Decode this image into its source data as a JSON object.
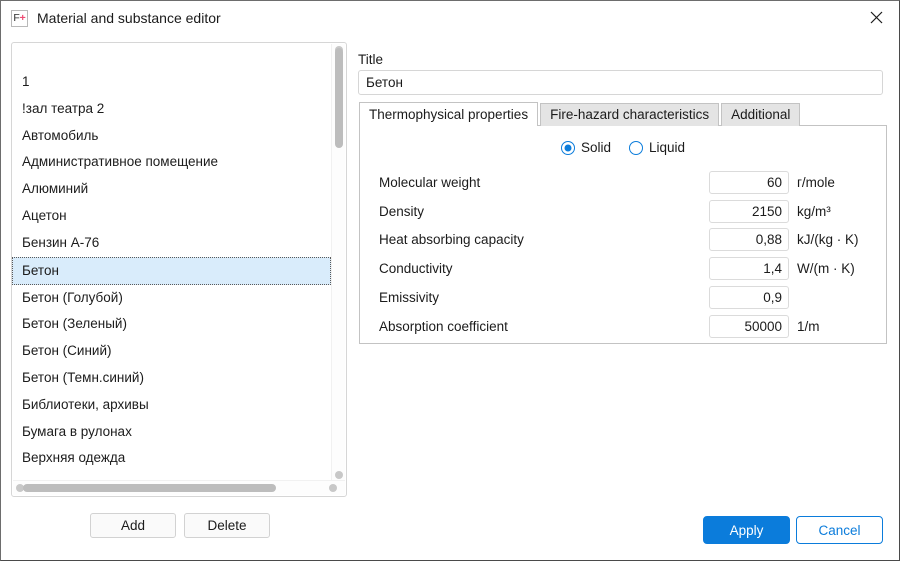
{
  "window": {
    "title": "Material and substance editor",
    "icon": "app-logo-icon",
    "icon_f": "F",
    "icon_plus": "+",
    "close_icon": "close-icon"
  },
  "material_list": {
    "items": [
      "1",
      "!зал театра 2",
      "Автомобиль",
      "Административное помещение",
      "Алюминий",
      "Ацетон",
      "Бензин А-76",
      "Бетон",
      "Бетон (Голубой)",
      "Бетон (Зеленый)",
      "Бетон (Синий)",
      "Бетон (Темн.синий)",
      "Библиотеки, архивы",
      "Бумага в рулонах",
      "Верхняя одежда"
    ],
    "selected_index": 7,
    "selected_value": "Бетон"
  },
  "list_buttons": {
    "add_label": "Add",
    "delete_label": "Delete"
  },
  "editor": {
    "title_label": "Title",
    "title_value": "Бетон",
    "title_placeholder": ""
  },
  "tabs": [
    {
      "label": "Thermophysical properties",
      "active": true
    },
    {
      "label": "Fire-hazard characteristics",
      "active": false
    },
    {
      "label": "Additional",
      "active": false
    }
  ],
  "state": {
    "options": [
      {
        "label": "Solid",
        "checked": true
      },
      {
        "label": "Liquid",
        "checked": false
      }
    ]
  },
  "properties": [
    {
      "label": "Molecular weight",
      "value": "60",
      "unit": "г/mole"
    },
    {
      "label": "Density",
      "value": "2150",
      "unit": "kg/m³"
    },
    {
      "label": "Heat absorbing capacity",
      "value": "0,88",
      "unit": "kJ/(kg · K)"
    },
    {
      "label": "Conductivity",
      "value": "1,4",
      "unit": "W/(m · K)"
    },
    {
      "label": "Emissivity",
      "value": "0,9",
      "unit": ""
    },
    {
      "label": "Absorption coefficient",
      "value": "50000",
      "unit": "1/m"
    }
  ],
  "dialog_buttons": {
    "apply_label": "Apply",
    "cancel_label": "Cancel"
  },
  "colors": {
    "accent": "#0b7cdb",
    "selection": "#d9ecfb",
    "logo_plus": "#ef4a72"
  }
}
